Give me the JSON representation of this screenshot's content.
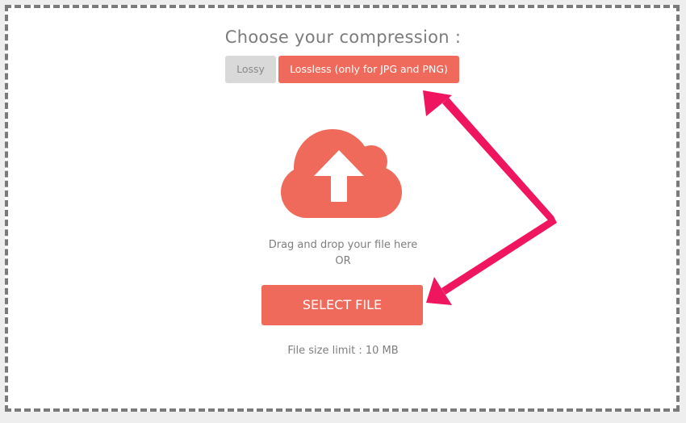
{
  "compression": {
    "title": "Choose your compression :",
    "options": [
      {
        "label": "Lossy",
        "active": false
      },
      {
        "label": "Lossless (only for JPG and PNG)",
        "active": true
      }
    ]
  },
  "upload": {
    "icon": "cloud-upload-icon",
    "drag_text": "Drag and drop your file here",
    "or_text": "OR",
    "select_button_label": "SELECT FILE",
    "size_limit_text": "File size limit : 10 MB"
  },
  "annotations": {
    "arrow_color": "#f0155f"
  },
  "colors": {
    "accent": "#ef6a5a",
    "inactive_button": "#d9d9d9",
    "text": "#7e7e7e",
    "border": "#7a7a7a"
  }
}
